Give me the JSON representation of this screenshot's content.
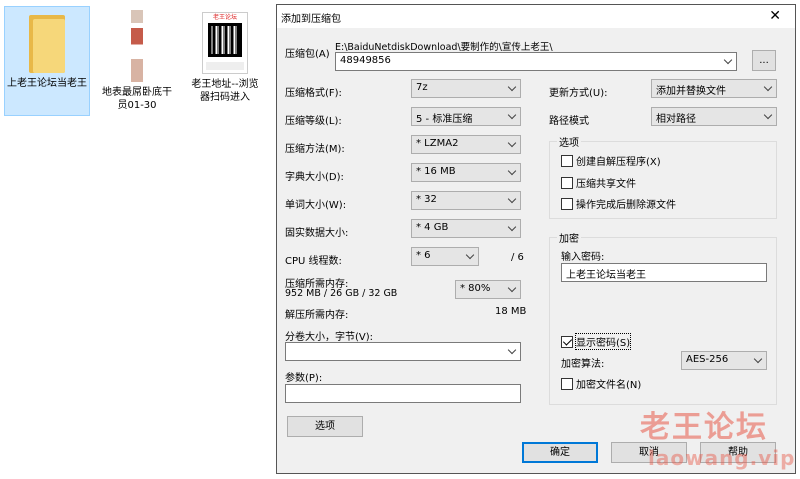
{
  "desktop": {
    "icons": [
      {
        "label": "上老王论坛当老王"
      },
      {
        "label": "地表最屌卧底干员01-30"
      },
      {
        "label": "老王地址--浏览器扫码进入"
      }
    ],
    "qr_title": "老王论坛"
  },
  "dialog": {
    "title": "添加到压缩包",
    "close_glyph": "✕",
    "archive": {
      "label": "压缩包(A)",
      "path": "E:\\BaiduNetdiskDownload\\要制作的\\宣传上老王\\",
      "value": "48949856",
      "browse_label": "..."
    },
    "left": {
      "format_label": "压缩格式(F):",
      "format_value": "7z",
      "level_label": "压缩等级(L):",
      "level_value": "5 - 标准压缩",
      "method_label": "压缩方法(M):",
      "method_value": "* LZMA2",
      "dict_label": "字典大小(D):",
      "dict_value": "* 16 MB",
      "word_label": "单词大小(W):",
      "word_value": "* 32",
      "solid_label": "固实数据大小:",
      "solid_value": "* 4 GB",
      "threads_label": "CPU 线程数:",
      "threads_value": "* 6",
      "threads_max": "/ 6",
      "mem_label": "压缩所需内存:",
      "mem_detail": "952 MB / 26 GB / 32 GB",
      "mem_value": "* 80%",
      "decomp_label": "解压所需内存:",
      "decomp_value": "18 MB",
      "split_label": "分卷大小，字节(V):",
      "split_value": "",
      "params_label": "参数(P):",
      "params_value": "",
      "options_button": "选项"
    },
    "right": {
      "update_label": "更新方式(U):",
      "update_value": "添加并替换文件",
      "path_label": "路径模式",
      "path_value": "相对路径",
      "options_group": "选项",
      "opt_sfx": "创建自解压程序(X)",
      "opt_shared": "压缩共享文件",
      "opt_delete": "操作完成后删除源文件",
      "encrypt_group": "加密",
      "password_label": "输入密码:",
      "password_value": "上老王论坛当老王",
      "show_password": "显示密码(S)",
      "method_label": "加密算法:",
      "method_value": "AES-256",
      "encrypt_names": "加密文件名(N)"
    },
    "buttons": {
      "ok": "确定",
      "cancel": "取消",
      "help": "帮助"
    }
  },
  "watermark": {
    "cn": "老王论坛",
    "url": "laowang.vip"
  }
}
